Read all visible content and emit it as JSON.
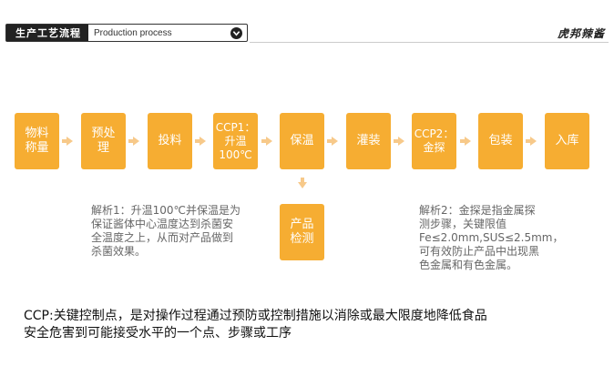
{
  "header": {
    "title": "生产工艺流程",
    "subtitle": "Production process",
    "icon": "chevron-down-icon",
    "brand": "虎邦辣酱"
  },
  "colors": {
    "step": "#f6ad32",
    "arrow": "#f7c98a",
    "note": "#666666"
  },
  "steps": [
    {
      "label": "物料\n称量"
    },
    {
      "label": "预处\n理"
    },
    {
      "label": "投料"
    },
    {
      "label": "CCP1：\n升温\n100℃"
    },
    {
      "label": "保温"
    },
    {
      "label": "灌装"
    },
    {
      "label": "CCP2：\n金探"
    },
    {
      "label": "包装"
    },
    {
      "label": "入库"
    }
  ],
  "branch_step": {
    "label": "产品\n检测"
  },
  "notes": {
    "analysis1": "解析1：升温100℃并保温是为\n保证酱体中心温度达到杀菌安\n全温度之上，从而对产品做到\n杀菌效果。",
    "analysis2": "解析2：金探是指金属探\n测步骤，关键限值\nFe≤2.0mm,SUS≤2.5mm，\n可有效防止产品中出现黑\n色金属和有色金属。"
  },
  "footer": {
    "definition": "CCP:关键控制点，是对操作过程通过预防或控制措施以消除或最大限度地降低食品\n安全危害到可能接受水平的一个点、步骤或工序"
  }
}
